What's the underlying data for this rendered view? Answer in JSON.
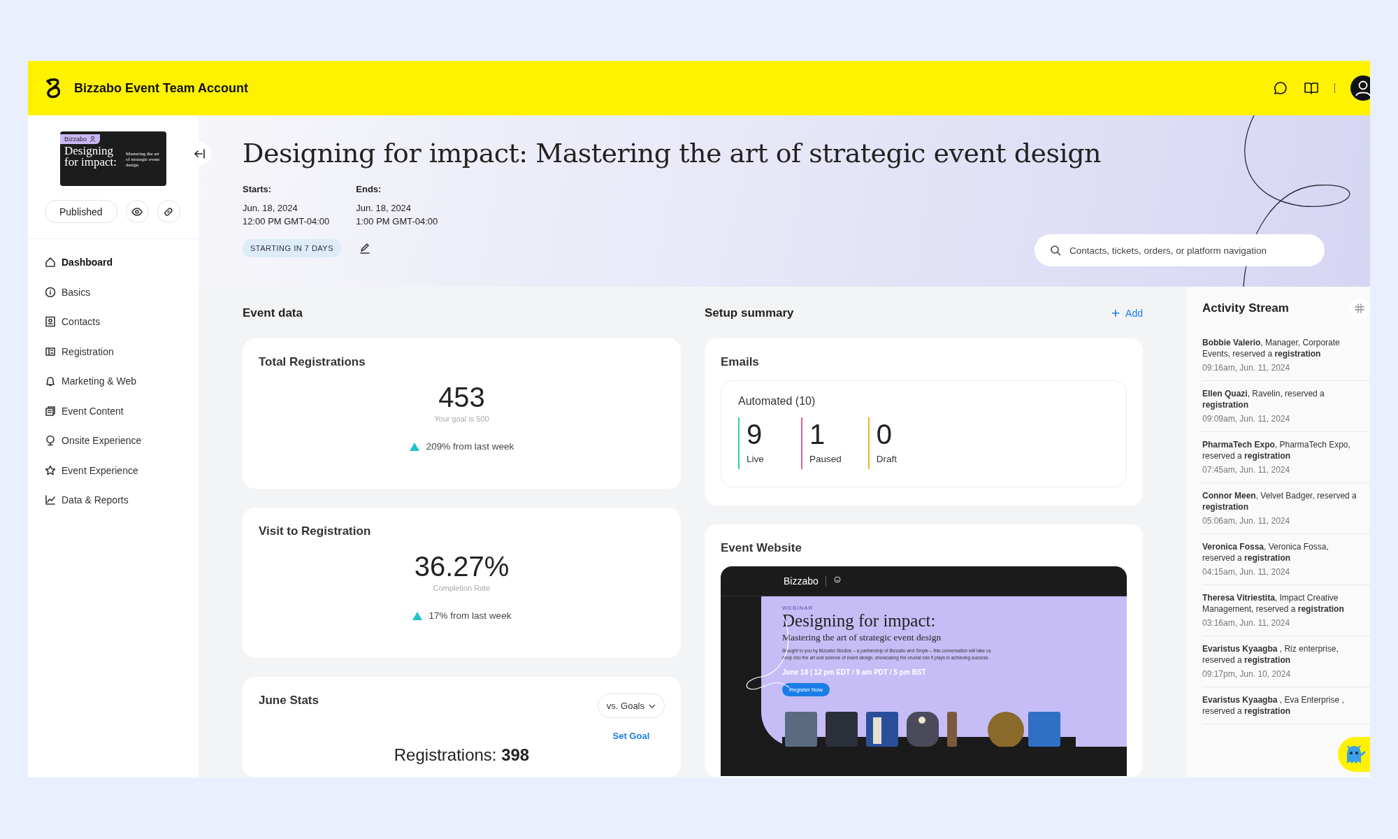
{
  "topbar": {
    "account": "Bizzabo Event Team Account"
  },
  "sidebar": {
    "thumbnail": {
      "brand": "Bizzabo",
      "title": "Designing for impact:",
      "subtitle": "Mastering the art of strategic event design"
    },
    "status": "Published",
    "nav": [
      {
        "label": "Dashboard",
        "selected": true
      },
      {
        "label": "Basics",
        "selected": false
      },
      {
        "label": "Contacts",
        "selected": false
      },
      {
        "label": "Registration",
        "selected": false
      },
      {
        "label": "Marketing & Web",
        "selected": false
      },
      {
        "label": "Event Content",
        "selected": false
      },
      {
        "label": "Onsite Experience",
        "selected": false
      },
      {
        "label": "Event Experience",
        "selected": false
      },
      {
        "label": "Data & Reports",
        "selected": false
      }
    ]
  },
  "event": {
    "title": "Designing for impact: Mastering the art of strategic event design",
    "dates": [
      {
        "label": "Starts:",
        "date": "Jun. 18, 2024",
        "time": "12:00 PM GMT-04:00"
      },
      {
        "label": "Ends:",
        "date": "Jun. 18, 2024",
        "time": "1:00 PM GMT-04:00"
      }
    ],
    "badge": "STARTING IN 7 DAYS"
  },
  "search": {
    "placeholder": "Contacts, tickets, orders, or platform navigation"
  },
  "event_data": {
    "heading": "Event data",
    "cards": [
      {
        "title": "Total Registrations",
        "value": "453",
        "caption": "Your goal is 500",
        "trend": "209% from last week"
      },
      {
        "title": "Visit to Registration",
        "value": "36.27%",
        "caption": "Completion Rate",
        "trend": "17% from last week"
      }
    ],
    "june_stats": {
      "title": "June Stats",
      "dropdown": "vs. Goals",
      "link": "Set Goal",
      "summary": "Registrations: **398**"
    }
  },
  "setup_summary": {
    "heading": "Setup summary",
    "add": "Add",
    "emails": {
      "title": "Emails",
      "group": "Automated (10)",
      "stats": [
        {
          "value": "9",
          "label": "Live",
          "color": "#2fd3a0"
        },
        {
          "value": "1",
          "label": "Paused",
          "color": "#e6607e"
        },
        {
          "value": "0",
          "label": "Draft",
          "color": "#f0b429"
        }
      ]
    },
    "website": {
      "title": "Event Website",
      "preview": {
        "brand": "Bizzabo",
        "eyebrow": "WEBINAR",
        "title": "Designing for impact:",
        "subtitle": "Mastering the art of strategic event design",
        "blurb": "Brought to you by Bizzabo Studios – a partnership of Bizzabo and Smyle – this conversation will take us deep into the art and science of event design, showcasing the crucial role it plays in achieving success.",
        "schedule": "June 18 | 12 pm EDT / 9 am PDT / 5 pm BST",
        "button": "Register Now"
      }
    }
  },
  "activity_stream": {
    "title": "Activity Stream",
    "items": [
      {
        "text": "**Bobbie Valerio**, Manager, Corporate Events, reserved a **registration**",
        "time": "09:16am, Jun. 11, 2024"
      },
      {
        "text": "**Ellen Quazi**, Ravelin, reserved a **registration**",
        "time": "09:09am, Jun. 11, 2024"
      },
      {
        "text": "**PharmaTech Expo**, PharmaTech Expo, reserved a **registration**",
        "time": "07:45am, Jun. 11, 2024"
      },
      {
        "text": "**Connor Meen**, Velvet Badger, reserved a **registration**",
        "time": "05:06am, Jun. 11, 2024"
      },
      {
        "text": "**Veronica Fossa**, Veronica Fossa, reserved a **registration**",
        "time": "04:15am, Jun. 11, 2024"
      },
      {
        "text": "**Theresa Vitriestita**, Impact Creative Management, reserved a **registration**",
        "time": "03:16am, Jun. 11, 2024"
      },
      {
        "text": "**Evaristus Kyaagba** , Riz enterprise, reserved a **registration**",
        "time": "09:17pm, Jun. 10, 2024"
      },
      {
        "text": "**Evaristus Kyaagba** , Eva Enterprise , reserved a **registration**"
      }
    ]
  }
}
